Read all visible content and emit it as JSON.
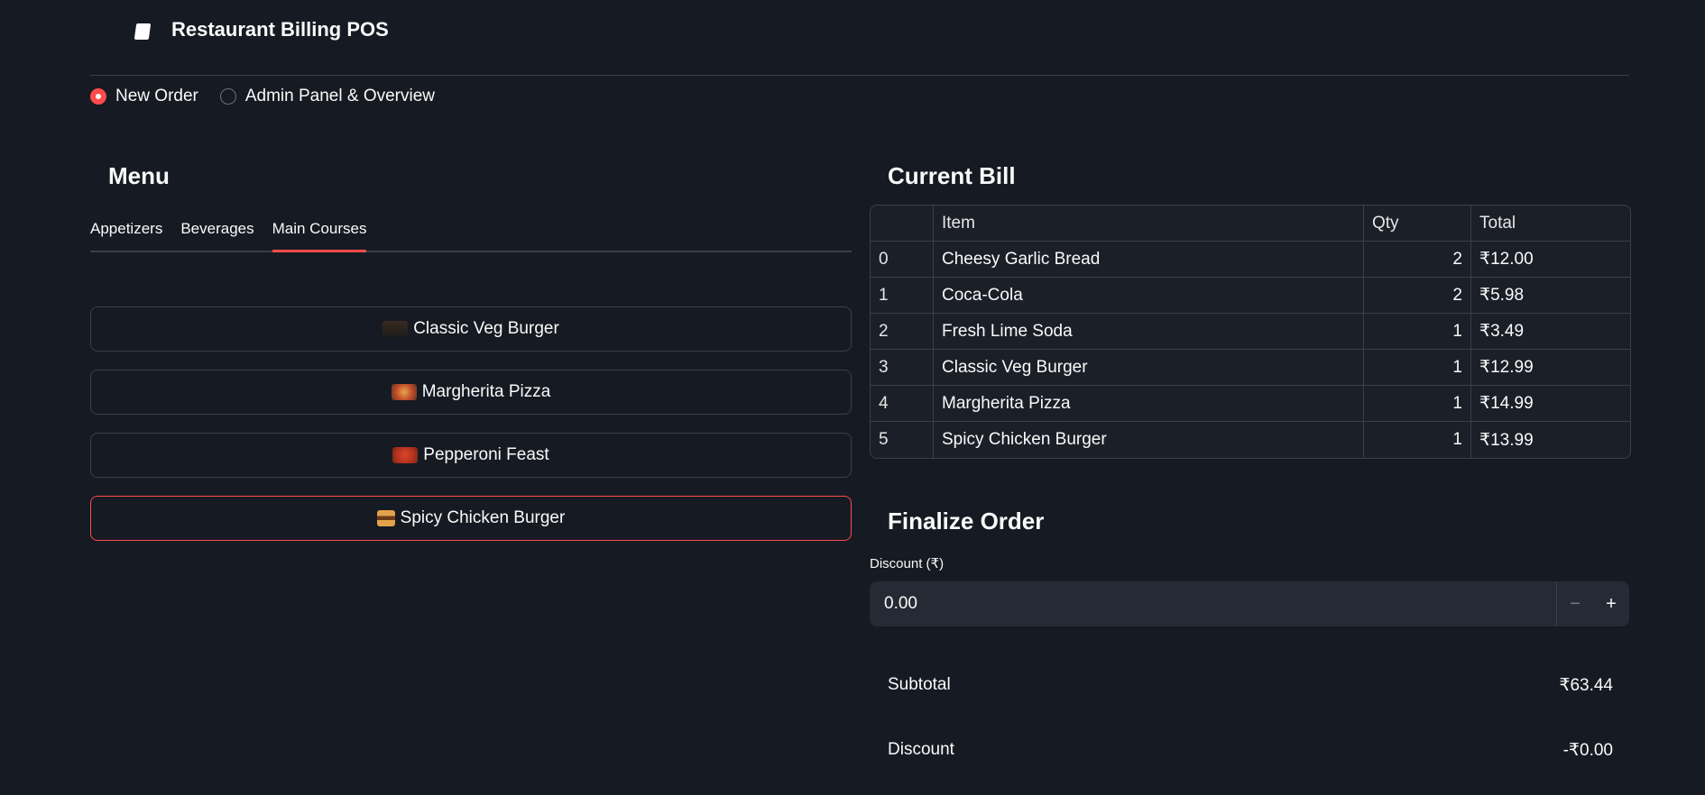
{
  "app": {
    "title": "Restaurant Billing POS"
  },
  "mode": {
    "options": [
      {
        "label": "New Order",
        "selected": true
      },
      {
        "label": "Admin Panel & Overview",
        "selected": false
      }
    ]
  },
  "menu": {
    "title": "Menu",
    "tabs": [
      {
        "label": "Appetizers",
        "active": false
      },
      {
        "label": "Beverages",
        "active": false
      },
      {
        "label": "Main Courses",
        "active": true
      }
    ],
    "items": [
      {
        "label": "Classic Veg Burger",
        "icon": "burger-photo-icon"
      },
      {
        "label": "Margherita Pizza",
        "icon": "pizza-photo-icon"
      },
      {
        "label": "Pepperoni Feast",
        "icon": "pepperoni-photo-icon"
      },
      {
        "label": "Spicy Chicken Burger",
        "icon": "burger-emoji-icon"
      }
    ]
  },
  "bill": {
    "title": "Current Bill",
    "columns": [
      "",
      "Item",
      "Qty",
      "Total"
    ],
    "rows": [
      {
        "idx": "0",
        "item": "Cheesy Garlic Bread",
        "qty": "2",
        "total": "₹12.00"
      },
      {
        "idx": "1",
        "item": "Coca-Cola",
        "qty": "2",
        "total": "₹5.98"
      },
      {
        "idx": "2",
        "item": "Fresh Lime Soda",
        "qty": "1",
        "total": "₹3.49"
      },
      {
        "idx": "3",
        "item": "Classic Veg Burger",
        "qty": "1",
        "total": "₹12.99"
      },
      {
        "idx": "4",
        "item": "Margherita Pizza",
        "qty": "1",
        "total": "₹14.99"
      },
      {
        "idx": "5",
        "item": "Spicy Chicken Burger",
        "qty": "1",
        "total": "₹13.99"
      }
    ]
  },
  "finalize": {
    "title": "Finalize Order",
    "discount_label": "Discount (₹)",
    "discount_value": "0.00",
    "minus": "−",
    "plus": "+",
    "subtotal_label": "Subtotal",
    "subtotal_value": "₹63.44",
    "discount_row_label": "Discount",
    "discount_row_value": "-₹0.00"
  },
  "colors": {
    "accent": "#ff4b4b",
    "background": "#161a22"
  }
}
